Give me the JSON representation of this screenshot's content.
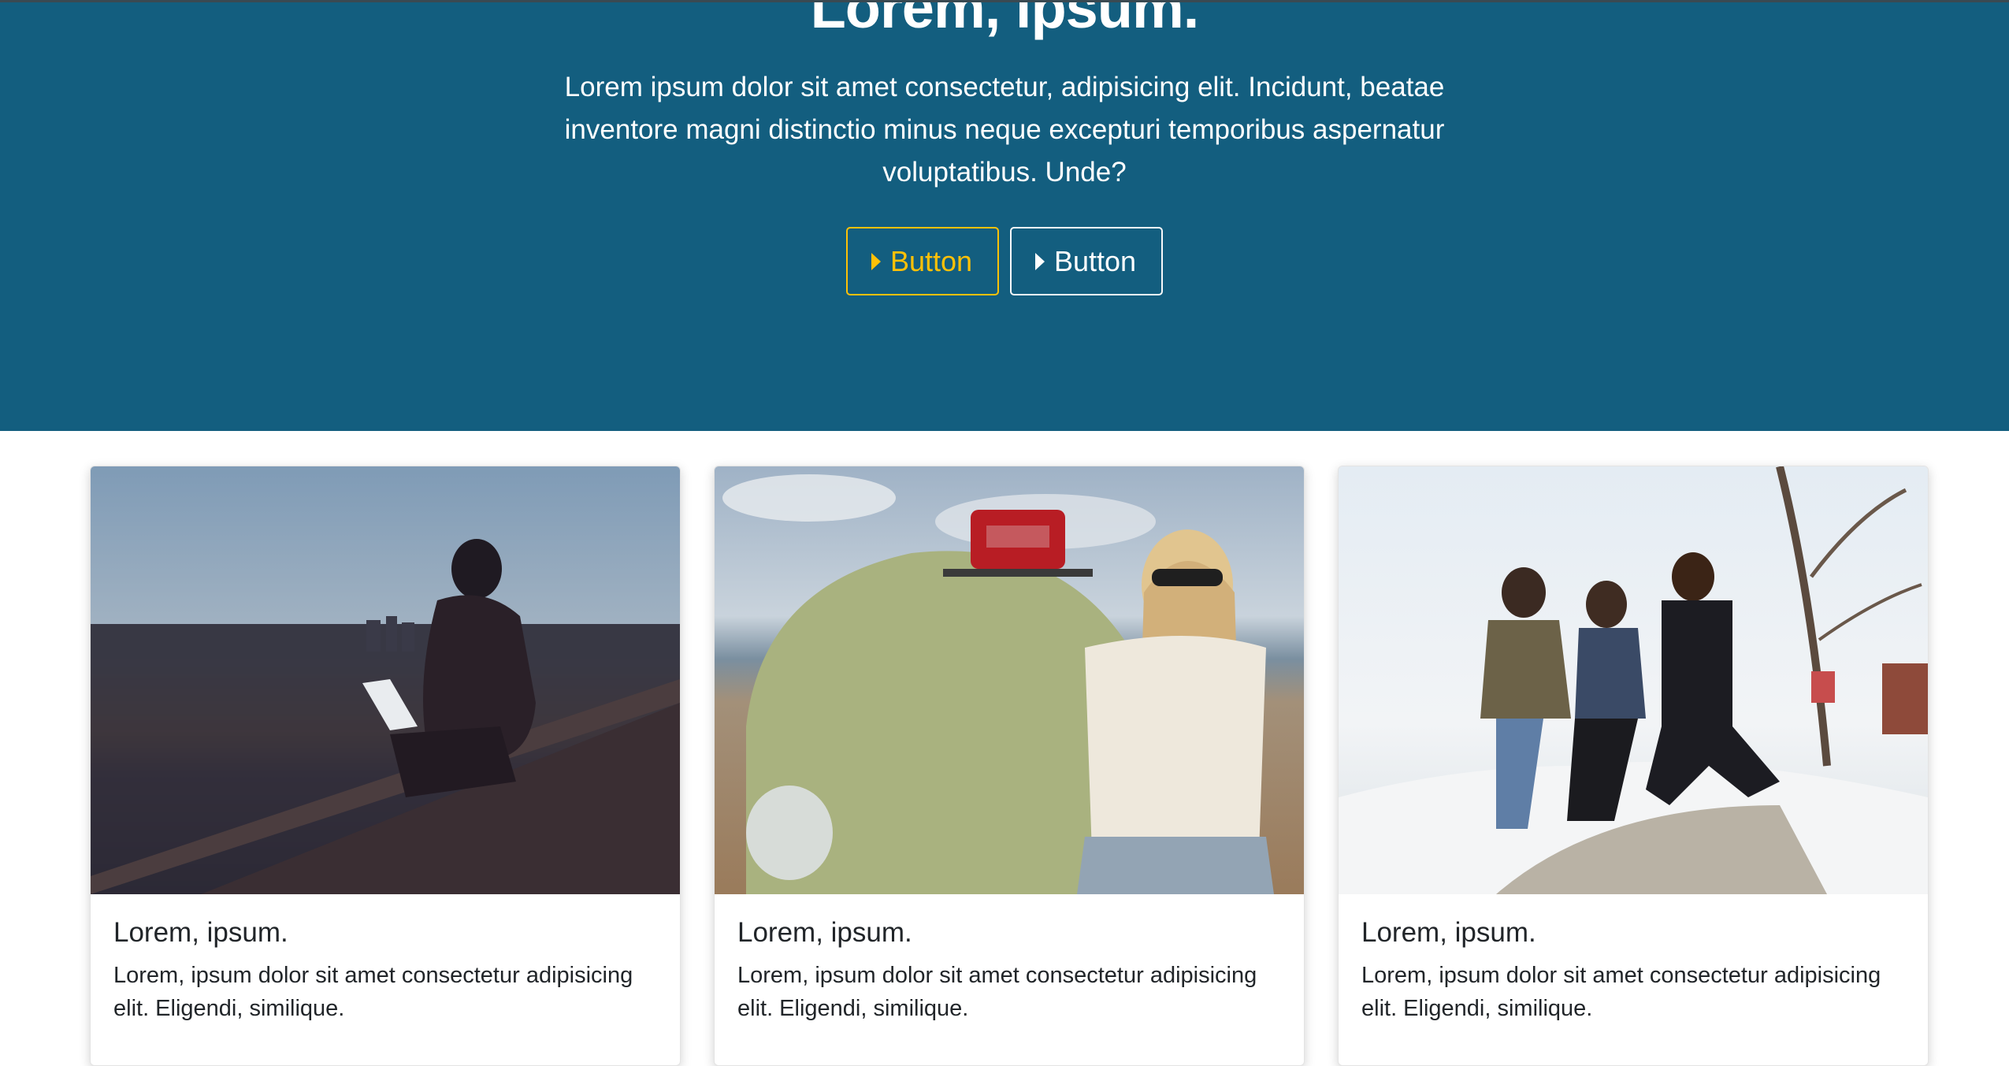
{
  "hero": {
    "title": "Lorem, ipsum.",
    "text": "Lorem ipsum dolor sit amet consectetur, adipisicing elit. Incidunt, beatae inventore magni distinctio minus neque excepturi temporibus aspernatur voluptatibus. Unde?",
    "buttons": [
      {
        "label": "Button",
        "icon": "caret-right-icon",
        "style": "outline-warning",
        "color": "#ffc107"
      },
      {
        "label": "Button",
        "icon": "caret-right-icon",
        "style": "outline-light",
        "color": "#f8f9fa"
      }
    ],
    "background": "#135e7f"
  },
  "cards": [
    {
      "image": "man-with-laptop-at-sunset",
      "title": "Lorem, ipsum.",
      "text": "Lorem, ipsum dolor sit amet consectetur adipisicing elit. Eligendi, similique."
    },
    {
      "image": "woman-with-vintage-car",
      "title": "Lorem, ipsum.",
      "text": "Lorem, ipsum dolor sit amet consectetur adipisicing elit. Eligendi, similique."
    },
    {
      "image": "friends-jumping-in-snow",
      "title": "Lorem, ipsum.",
      "text": "Lorem, ipsum dolor sit amet consectetur adipisicing elit. Eligendi, similique."
    }
  ]
}
